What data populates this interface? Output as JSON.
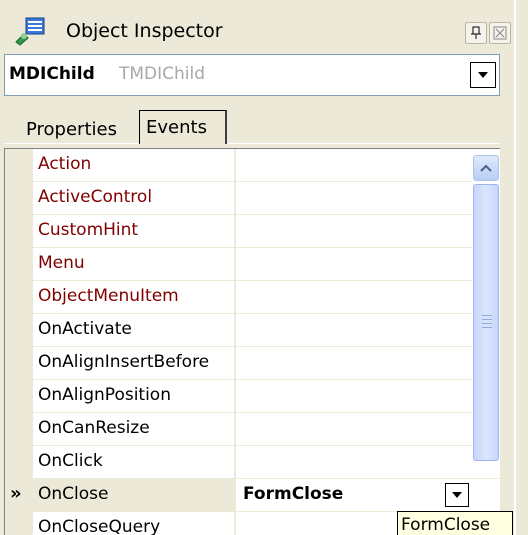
{
  "window": {
    "title": "Object Inspector",
    "icons": {
      "app": "object-inspector-icon",
      "pin": "pin-icon",
      "close": "close-icon"
    }
  },
  "selector": {
    "name": "MDIChild",
    "type": "TMDIChild"
  },
  "tabs": [
    {
      "label": "Properties",
      "active": false
    },
    {
      "label": "Events",
      "active": true
    }
  ],
  "events": {
    "rows": [
      {
        "name": "Action",
        "value": "",
        "color": "#800000"
      },
      {
        "name": "ActiveControl",
        "value": "",
        "color": "#800000"
      },
      {
        "name": "CustomHint",
        "value": "",
        "color": "#800000"
      },
      {
        "name": "Menu",
        "value": "",
        "color": "#800000"
      },
      {
        "name": "ObjectMenuItem",
        "value": "",
        "color": "#800000"
      },
      {
        "name": "OnActivate",
        "value": ""
      },
      {
        "name": "OnAlignInsertBefore",
        "value": ""
      },
      {
        "name": "OnAlignPosition",
        "value": ""
      },
      {
        "name": "OnCanResize",
        "value": ""
      },
      {
        "name": "OnClick",
        "value": ""
      },
      {
        "name": "OnClose",
        "value": "FormClose",
        "selected": true
      },
      {
        "name": "OnCloseQuery",
        "value": ""
      }
    ],
    "selected_marker": "»"
  },
  "tooltip": {
    "text": "FormClose"
  }
}
